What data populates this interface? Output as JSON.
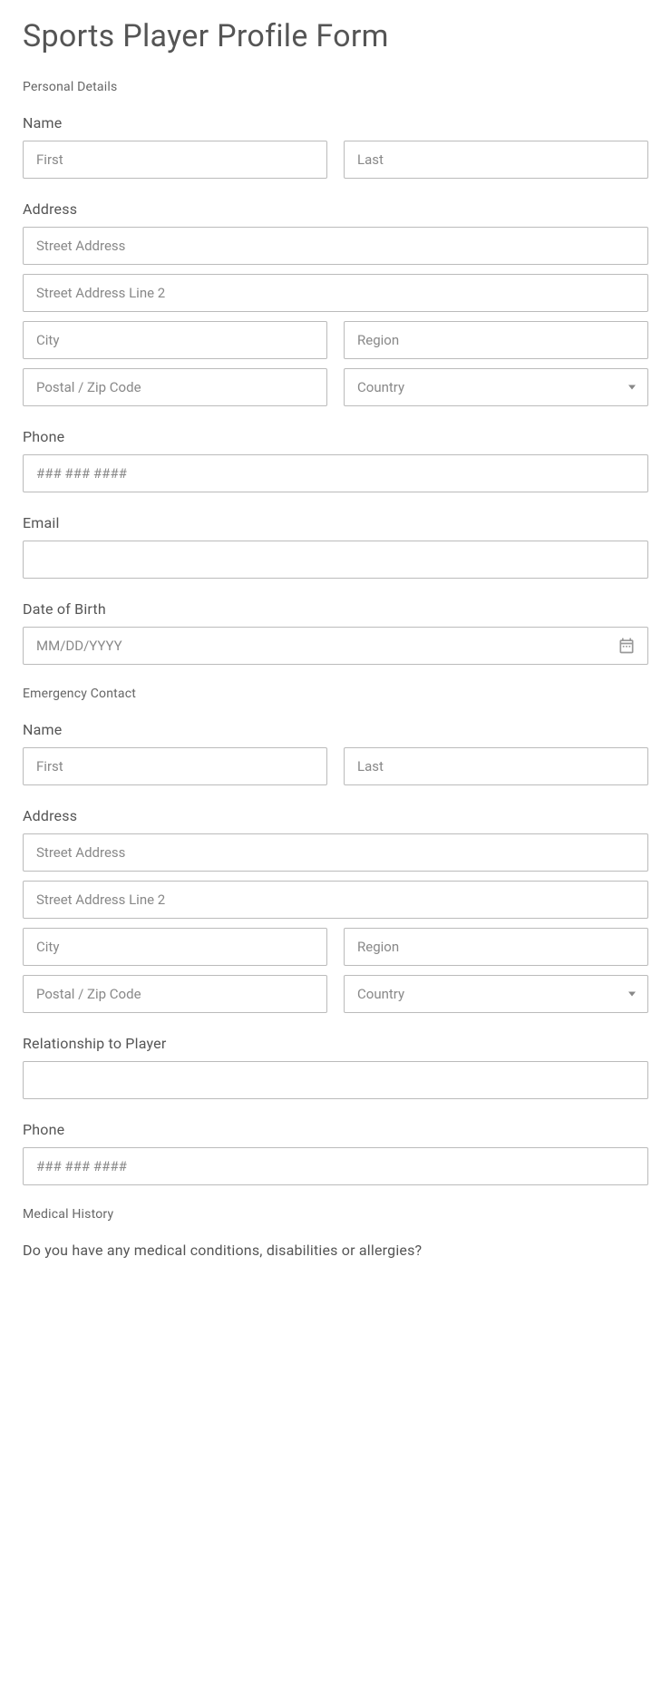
{
  "title": "Sports Player Profile Form",
  "sections": {
    "personal": "Personal Details",
    "emergency": "Emergency Contact",
    "medical": "Medical History"
  },
  "labels": {
    "name": "Name",
    "address": "Address",
    "phone": "Phone",
    "email": "Email",
    "dob": "Date of Birth",
    "relationship": "Relationship to Player",
    "medicalQ": "Do you have any medical conditions, disabilities or allergies?"
  },
  "placeholders": {
    "first": "First",
    "last": "Last",
    "street1": "Street Address",
    "street2": "Street Address Line 2",
    "city": "City",
    "region": "Region",
    "postal": "Postal / Zip Code",
    "country": "Country",
    "phone": "### ### ####",
    "dob": "MM/DD/YYYY"
  }
}
